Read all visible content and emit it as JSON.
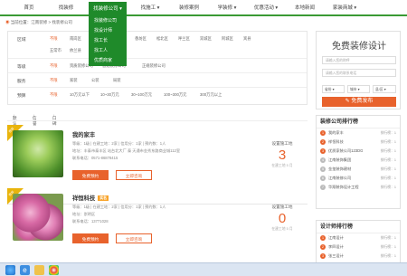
{
  "nav": {
    "items": [
      "首页",
      "找装修",
      "找装修公司",
      "找施工",
      "装修案例",
      "学装修",
      "优惠活动",
      "本地新闻",
      "家装商城"
    ],
    "active_index": 2,
    "dropdown": [
      "找装修公司",
      "找设计师",
      "找工长",
      "找工人",
      "优质商家"
    ]
  },
  "breadcrumb": "当前位置：江南装修 > 找装修公司",
  "filters": [
    {
      "label": "区域",
      "options": [
        "不限",
        "南岗区",
        "道里区",
        "道外区",
        "香坊区",
        "松北区",
        "呼兰区",
        "双城区",
        "阿城区",
        "宾县",
        "五常市",
        "依兰县",
        "巴彦县"
      ],
      "selected": 0
    },
    {
      "label": "等级",
      "options": [
        "不限",
        "资质装修公司",
        "普通装修公司",
        "正规装修公司"
      ],
      "selected": 0
    },
    {
      "label": "服务",
      "options": [
        "不限",
        "家装",
        "公装",
        "局装"
      ],
      "selected": 0
    },
    {
      "label": "预算",
      "options": [
        "不限",
        "10万元以下",
        "10~30万元",
        "30~100万元",
        "100~300万元",
        "300万元以上"
      ],
      "selected": 0
    }
  ],
  "sort": [
    "默认",
    "信誉",
    "口碑"
  ],
  "companies": [
    {
      "name": "我的家丰",
      "badge": "",
      "ribbon": "推荐",
      "info": "等级：1级 | 在建工地：2家 | 信用分：1家 | 预约数：1人",
      "address": "地址：丰泰市泰丰区 站台北大厂 泰 天通市金秀东路商业城112室",
      "phone": "联系电话：0571-86878415",
      "sites_label": "设置施工地",
      "sites": "3",
      "sites_sub": "在建工地 5 月"
    },
    {
      "name": "祥恒科技",
      "badge": "实名",
      "ribbon": "推荐",
      "info": "等级：1级 | 在建工地：2家 | 信用分：1家 | 预约数：1人",
      "address": "地址：崇明区",
      "phone": "联系电话：13771028",
      "sites_label": "设置施工地",
      "sites": "0",
      "sites_sub": "在建工地 5 月"
    }
  ],
  "buttons": {
    "book": "免费预约",
    "visit": "立即咨询"
  },
  "design_form": {
    "title": "免费装修设计",
    "name_placeholder": "请输入您的称呼",
    "phone_placeholder": "请输入您的联系电话",
    "selects": [
      "省份",
      "城市",
      "县/区"
    ],
    "submit": "免费发布"
  },
  "rank_panel": {
    "title": "装修公司排行榜",
    "items": [
      {
        "name": "我的家丰",
        "right": "排行榜：1"
      },
      {
        "name": "祥恒科技",
        "right": "排行榜：1"
      },
      {
        "name": "优质家装公司123DG",
        "right": "排行榜：1"
      },
      {
        "name": "江南装饰集团",
        "right": "排行榜：1"
      },
      {
        "name": "金玺装饰建材",
        "right": "排行榜：1"
      },
      {
        "name": "江南装修公司",
        "right": "排行榜：1"
      },
      {
        "name": "华翔装饰设计工程",
        "right": "排行榜：1"
      }
    ]
  },
  "design_panel": {
    "title": "设计师排行榜",
    "items": [
      {
        "name": "江南设计",
        "right": "排行榜：1"
      },
      {
        "name": "李四设计",
        "right": "排行榜：1"
      },
      {
        "name": "张三设计",
        "right": "排行榜：1"
      },
      {
        "name": "王五设计",
        "right": "排行榜：1"
      }
    ]
  },
  "taskbar": {
    "apps": [
      "start",
      "ie",
      "folder",
      "browser"
    ]
  }
}
